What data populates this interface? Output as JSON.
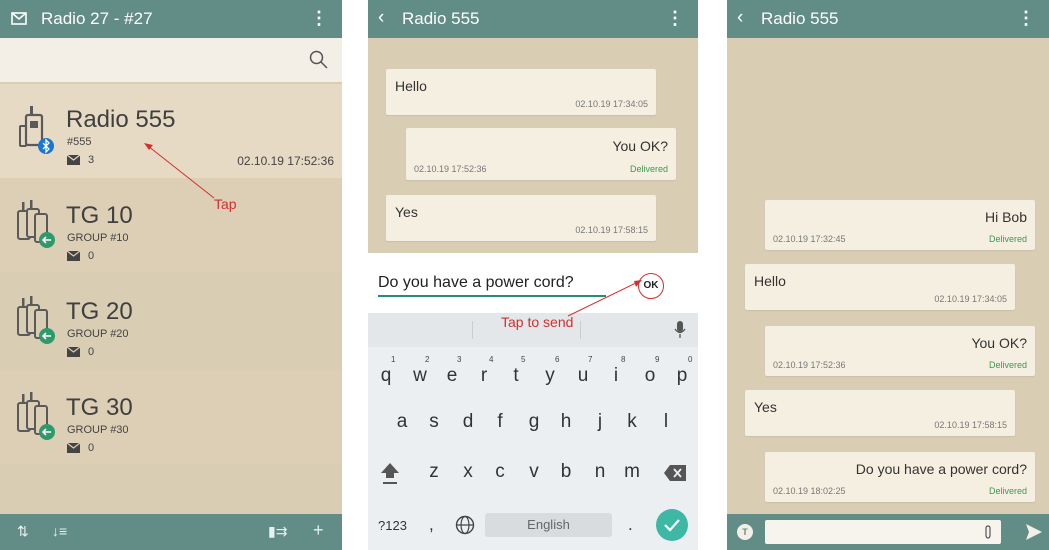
{
  "panel1": {
    "title": "Radio 27 - #27",
    "contacts": [
      {
        "name": "Radio 555",
        "sub": "#555",
        "count": "3",
        "time": "02.10.19 17:52:36"
      },
      {
        "name": "TG 10",
        "sub": "GROUP #10",
        "count": "0"
      },
      {
        "name": "TG 20",
        "sub": "GROUP #20",
        "count": "0"
      },
      {
        "name": "TG 30",
        "sub": "GROUP #30",
        "count": "0"
      }
    ],
    "annotation": "Tap"
  },
  "panel2": {
    "title": "Radio 555",
    "messages": [
      {
        "text": "Hello",
        "time": "02.10.19 17:34:05"
      },
      {
        "text": "You OK?",
        "time": "02.10.19 17:52:36",
        "status": "Delivered"
      },
      {
        "text": "Yes",
        "time": "02.10.19 17:58:15"
      }
    ],
    "compose_text": "Do you have a power cord?",
    "ok_label": "OK",
    "annotation": "Tap to send",
    "keyboard": {
      "row1": [
        "q",
        "w",
        "e",
        "r",
        "t",
        "y",
        "u",
        "i",
        "o",
        "p"
      ],
      "row1_nums": [
        "1",
        "2",
        "3",
        "4",
        "5",
        "6",
        "7",
        "8",
        "9",
        "0"
      ],
      "row2": [
        "a",
        "s",
        "d",
        "f",
        "g",
        "h",
        "j",
        "k",
        "l"
      ],
      "row3": [
        "z",
        "x",
        "c",
        "v",
        "b",
        "n",
        "m"
      ],
      "symbols": "?123",
      "comma": ",",
      "space": "English",
      "period": "."
    }
  },
  "panel3": {
    "title": "Radio 555",
    "messages": [
      {
        "text": "Hi Bob",
        "time": "02.10.19 17:32:45",
        "status": "Delivered"
      },
      {
        "text": "Hello",
        "time": "02.10.19 17:34:05"
      },
      {
        "text": "You OK?",
        "time": "02.10.19 17:52:36",
        "status": "Delivered"
      },
      {
        "text": "Yes",
        "time": "02.10.19 17:58:15"
      },
      {
        "text": "Do you have a power cord?",
        "time": "02.10.19 18:02:25",
        "status": "Delivered"
      }
    ],
    "avatar_letter": "T"
  },
  "colors": {
    "bar": "#628c86",
    "background": "#d9cdb4",
    "bubble": "#f4efe0",
    "delivered": "#3a9a4e",
    "annotation": "#d32f2f",
    "accent": "#2a8a7c"
  },
  "icons": [
    "message-icon",
    "menu-icon",
    "search-icon",
    "radio-bluetooth-icon",
    "group-radio-icon",
    "mail-icon",
    "back-icon",
    "mic-icon",
    "shift-icon",
    "backspace-icon",
    "globe-icon",
    "check-icon",
    "sort-icon",
    "add-icon",
    "attach-icon",
    "send-icon"
  ]
}
